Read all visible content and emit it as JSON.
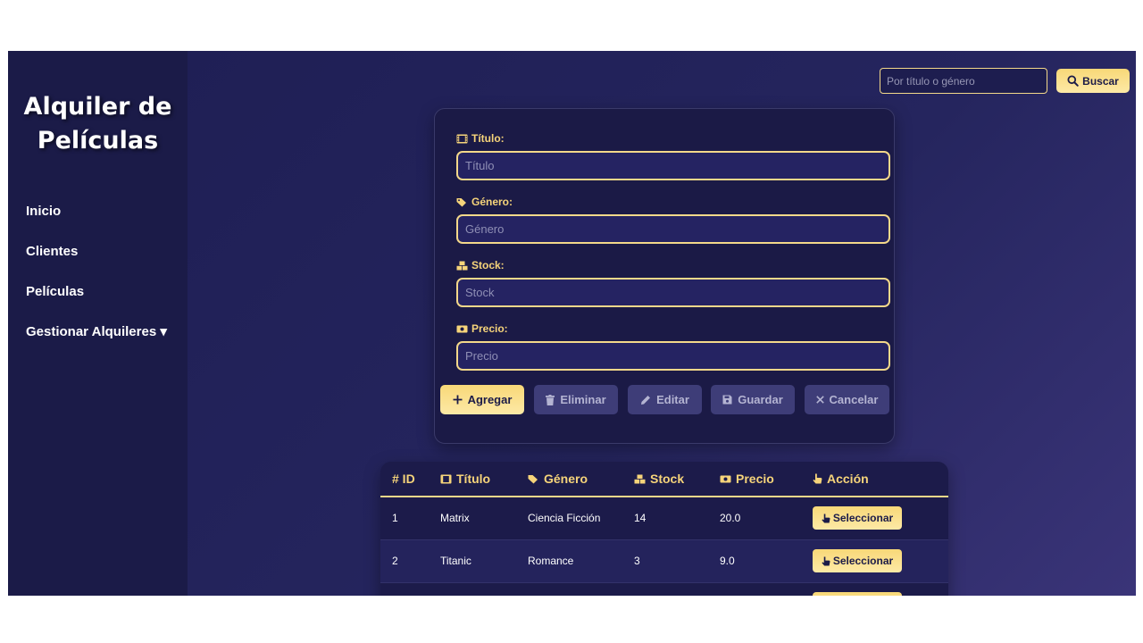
{
  "sidebar": {
    "brand": "Alquiler de Películas",
    "nav": [
      "Inicio",
      "Clientes",
      "Películas",
      "Gestionar Alquileres ▾"
    ]
  },
  "search": {
    "placeholder": "Por título o género",
    "button_label": "Buscar"
  },
  "form": {
    "fields": [
      {
        "label": "Título:",
        "placeholder": "Título",
        "icon": "film-icon"
      },
      {
        "label": "Género:",
        "placeholder": "Género",
        "icon": "tags-icon"
      },
      {
        "label": "Stock:",
        "placeholder": "Stock",
        "icon": "boxes-icon"
      },
      {
        "label": "Precio:",
        "placeholder": "Precio",
        "icon": "money-icon"
      }
    ],
    "buttons": {
      "add": "Agregar",
      "delete": "Eliminar",
      "edit": "Editar",
      "save": "Guardar",
      "cancel": "Cancelar"
    }
  },
  "table": {
    "columns": [
      "# ID",
      "Título",
      "Género",
      "Stock",
      "Precio",
      "Acción"
    ],
    "rows": [
      {
        "id": "1",
        "titulo": "Matrix",
        "genero": "Ciencia Ficción",
        "stock": "14",
        "precio": "20.0",
        "accion": "Seleccionar"
      },
      {
        "id": "2",
        "titulo": "Titanic",
        "genero": "Romance",
        "stock": "3",
        "precio": "9.0",
        "accion": "Seleccionar"
      }
    ]
  },
  "colors": {
    "accent": "#f6d47a",
    "sidebar": "#1b1b48",
    "background": "#25255e"
  }
}
